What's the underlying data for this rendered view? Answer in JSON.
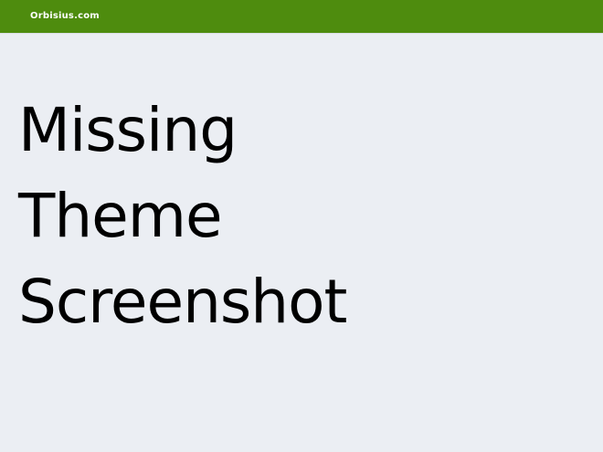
{
  "header": {
    "brand": "Orbisius.com"
  },
  "main": {
    "headline_lines": [
      "Missing",
      "Theme",
      "Screenshot"
    ]
  },
  "colors": {
    "header_bg": "#4e8c0e",
    "page_bg": "#ebeef3",
    "text": "#000000"
  }
}
